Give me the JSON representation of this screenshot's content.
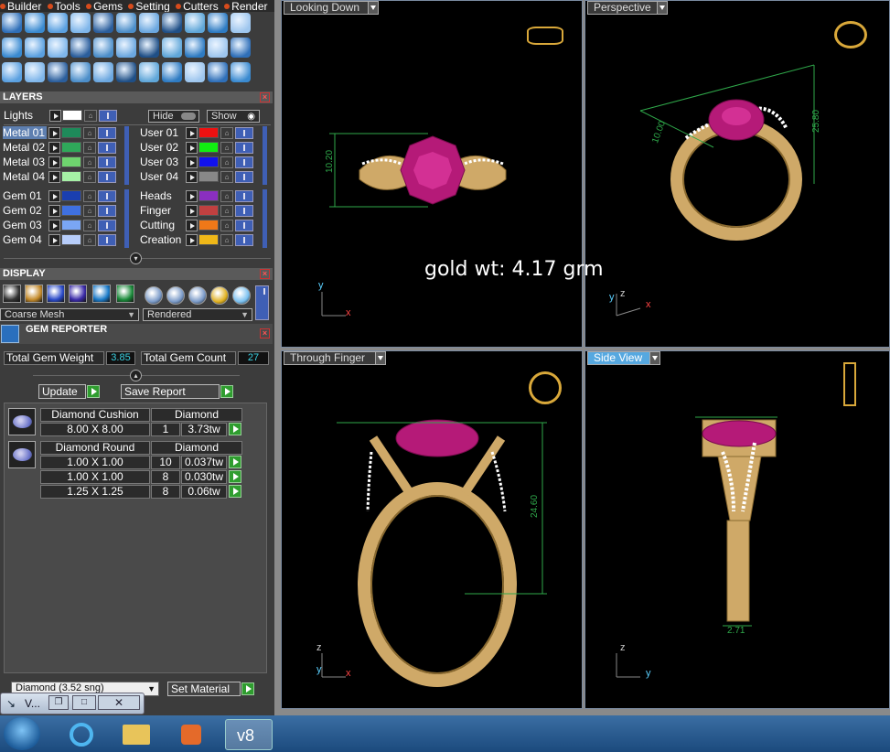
{
  "menu": [
    "Builder",
    "Tools",
    "Gems",
    "Setting",
    "Cutters",
    "Render"
  ],
  "layers": {
    "title": "LAYERS",
    "lights_label": "Lights",
    "hide_label": "Hide",
    "show_label": "Show",
    "left": [
      {
        "label": "Metal 01",
        "color": "#1e8a5a",
        "selected": true
      },
      {
        "label": "Metal 02",
        "color": "#2fa85a"
      },
      {
        "label": "Metal 03",
        "color": "#6ed36e"
      },
      {
        "label": "Metal 04",
        "color": "#a6f0a6"
      },
      {
        "label": "Gem 01",
        "color": "#1a3fb0"
      },
      {
        "label": "Gem 02",
        "color": "#3f70e0"
      },
      {
        "label": "Gem 03",
        "color": "#7aa6f4"
      },
      {
        "label": "Gem 04",
        "color": "#b7cdfa"
      }
    ],
    "right": [
      {
        "label": "User 01",
        "color": "#ee1111"
      },
      {
        "label": "User 02",
        "color": "#11ee11"
      },
      {
        "label": "User 03",
        "color": "#1111ee"
      },
      {
        "label": "User 04",
        "color": "#888888"
      },
      {
        "label": "Heads",
        "color": "#8a2fc0"
      },
      {
        "label": "Finger",
        "color": "#c04040"
      },
      {
        "label": "Cutting",
        "color": "#f07818"
      },
      {
        "label": "Creation",
        "color": "#f0b818"
      }
    ]
  },
  "display": {
    "title": "DISPLAY",
    "mesh_select": "Coarse Mesh",
    "render_select": "Rendered"
  },
  "gem_reporter": {
    "title": "GEM REPORTER",
    "total_weight_label": "Total Gem Weight",
    "total_weight": "3.85",
    "total_count_label": "Total Gem Count",
    "total_count": "27",
    "update_label": "Update",
    "save_label": "Save Report",
    "groups": [
      {
        "shape": "Diamond Cushion",
        "material": "Diamond",
        "rows": [
          {
            "size": "8.00 X 8.00",
            "count": "1",
            "weight": "3.73tw"
          }
        ]
      },
      {
        "shape": "Diamond Round",
        "material": "Diamond",
        "rows": [
          {
            "size": "1.00 X 1.00",
            "count": "10",
            "weight": "0.037tw"
          },
          {
            "size": "1.00 X 1.00",
            "count": "8",
            "weight": "0.030tw"
          },
          {
            "size": "1.25 X 1.25",
            "count": "8",
            "weight": "0.06tw"
          }
        ]
      }
    ],
    "material_select": "Diamond   (3.52 sng)",
    "set_material_label": "Set Material"
  },
  "viewports": {
    "top_left": {
      "title": "Looking Down",
      "dimension": "10.20"
    },
    "top_right": {
      "title": "Perspective",
      "dimension_a": "10.00",
      "dimension_b": "25.80"
    },
    "bottom_left": {
      "title": "Through Finger",
      "dimension": "24.60"
    },
    "bottom_right": {
      "title": "Side View",
      "dimension": "2.71"
    },
    "overlay_text": "gold wt: 4.17 grm"
  },
  "axes": {
    "x": "x",
    "y": "y",
    "z": "z"
  },
  "minimized_window": {
    "label": "V..."
  },
  "taskbar": {
    "app_label": "v8"
  },
  "colors": {
    "accent_blue": "#3f5fb5",
    "active_title": "#56a8e0",
    "gold": "#d9b77a",
    "ruby": "#c0187a"
  }
}
